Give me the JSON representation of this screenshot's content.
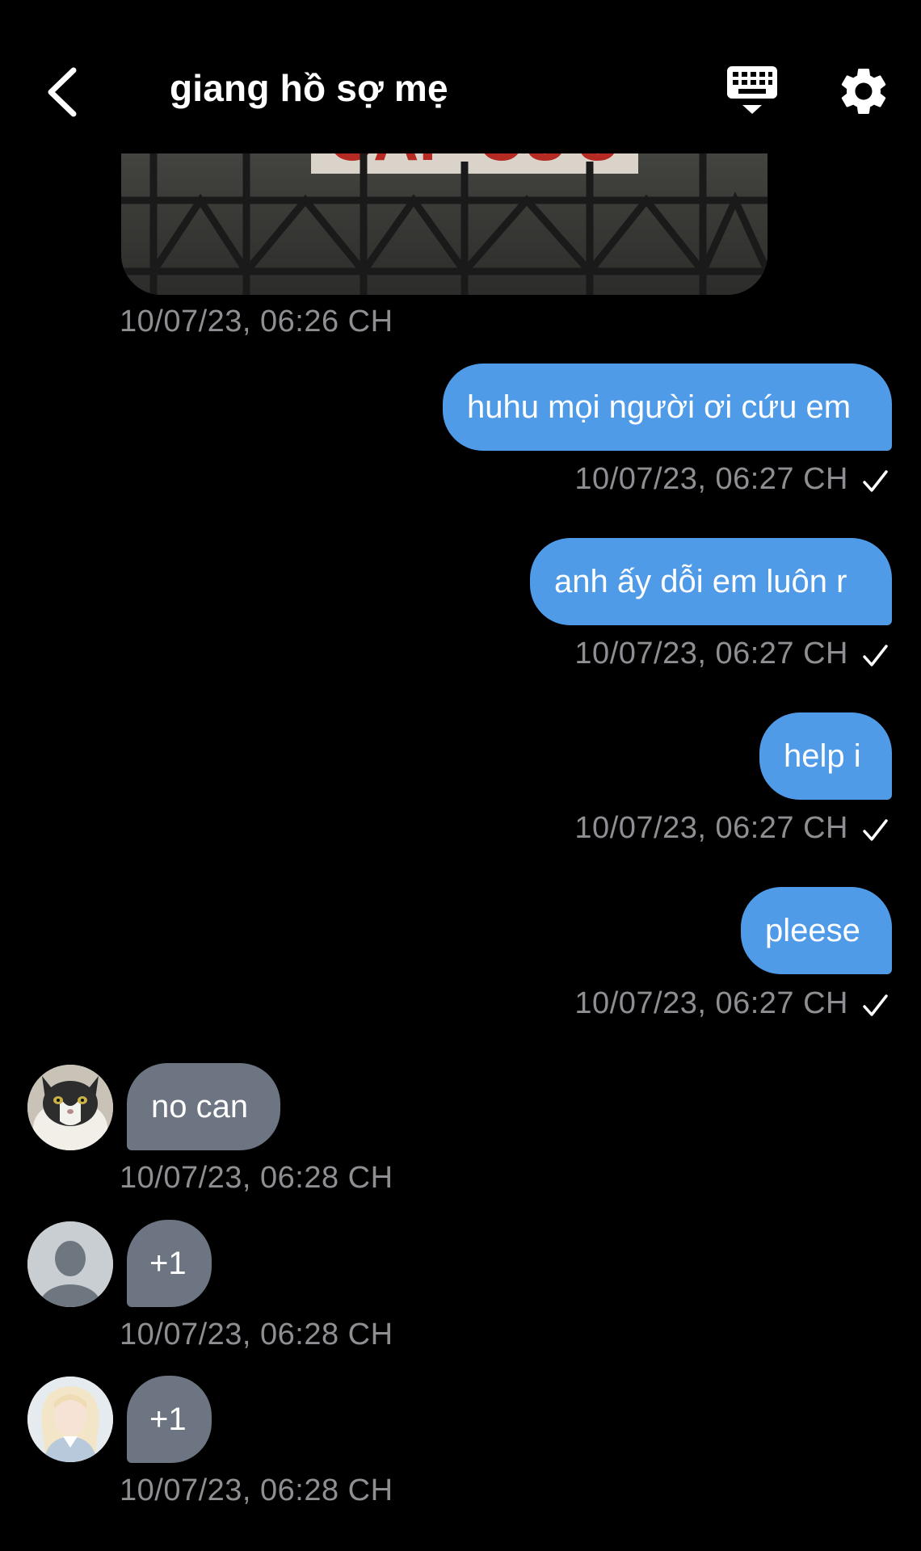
{
  "header": {
    "title": "giang hồ sợ mẹ"
  },
  "media_message": {
    "sign_text": "CẤP CỨU",
    "timestamp": "10/07/23, 06:26 CH"
  },
  "outgoing": [
    {
      "text": "huhu mọi người ơi cứu em",
      "timestamp": "10/07/23, 06:27 CH"
    },
    {
      "text": "anh ấy dỗi em luôn r",
      "timestamp": "10/07/23, 06:27 CH"
    },
    {
      "text": "help i",
      "timestamp": "10/07/23, 06:27 CH"
    },
    {
      "text": "pleese",
      "timestamp": "10/07/23, 06:27 CH"
    }
  ],
  "incoming": [
    {
      "text": "no can",
      "timestamp": "10/07/23, 06:28 CH",
      "avatar": "cat-avatar"
    },
    {
      "text": "+1",
      "timestamp": "10/07/23, 06:28 CH",
      "avatar": "default-avatar"
    },
    {
      "text": "+1",
      "timestamp": "10/07/23, 06:28 CH",
      "avatar": "girl-avatar"
    }
  ],
  "colors": {
    "background": "#000000",
    "outgoing_bubble": "#4f9be8",
    "incoming_bubble": "#6c7581",
    "timestamp": "#8e8e93"
  }
}
